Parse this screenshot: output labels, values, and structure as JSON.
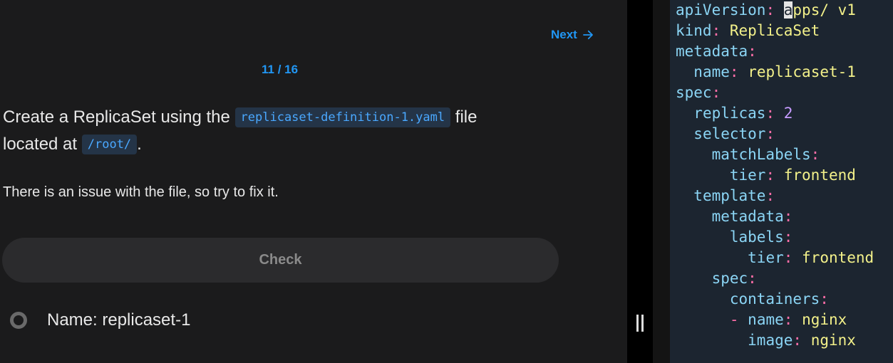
{
  "nav": {
    "next_label": "Next",
    "progress": "11 / 16"
  },
  "question": {
    "line1_prefix": "Create a ReplicaSet using the ",
    "file_chip": "replicaset-definition-1.yaml",
    "line1_suffix": " file",
    "line2_prefix": "located at ",
    "path_chip": "/root/",
    "line2_suffix": ".",
    "note": "There is an issue with the file, so try to fix it."
  },
  "check_label": "Check",
  "tasks": [
    {
      "label": "Name: replicaset-1"
    }
  ],
  "editor": {
    "lines": [
      {
        "indent": "",
        "key": "apiVersion",
        "cursor": "a",
        "value": "pps/ v1",
        "value_type": "string"
      },
      {
        "indent": "",
        "key": "kind",
        "value": "ReplicaSet",
        "value_type": "string"
      },
      {
        "indent": "",
        "key": "metadata",
        "value": "",
        "value_type": "none"
      },
      {
        "indent": "  ",
        "key": "name",
        "value": "replicaset-1",
        "value_type": "string"
      },
      {
        "indent": "",
        "key": "spec",
        "value": "",
        "value_type": "none"
      },
      {
        "indent": "  ",
        "key": "replicas",
        "value": "2",
        "value_type": "number"
      },
      {
        "indent": "  ",
        "key": "selector",
        "value": "",
        "value_type": "none"
      },
      {
        "indent": "    ",
        "key": "matchLabels",
        "value": "",
        "value_type": "none"
      },
      {
        "indent": "      ",
        "key": "tier",
        "value": "frontend",
        "value_type": "string"
      },
      {
        "indent": "  ",
        "key": "template",
        "value": "",
        "value_type": "none"
      },
      {
        "indent": "    ",
        "key": "metadata",
        "value": "",
        "value_type": "none"
      },
      {
        "indent": "      ",
        "key": "labels",
        "value": "",
        "value_type": "none"
      },
      {
        "indent": "        ",
        "key": "tier",
        "value": "frontend",
        "value_type": "string"
      },
      {
        "indent": "    ",
        "key": "spec",
        "value": "",
        "value_type": "none"
      },
      {
        "indent": "      ",
        "key": "containers",
        "value": "",
        "value_type": "none"
      },
      {
        "indent": "      ",
        "dash": true,
        "key": "name",
        "value": "nginx",
        "value_type": "string"
      },
      {
        "indent": "        ",
        "key": "image",
        "value": "nginx",
        "value_type": "string"
      }
    ]
  },
  "colors": {
    "accent": "#2196f3",
    "yaml_key": "#8bd5f5",
    "yaml_punct": "#ff6ea8",
    "yaml_string": "#f3f18a",
    "yaml_number": "#c69bff"
  }
}
